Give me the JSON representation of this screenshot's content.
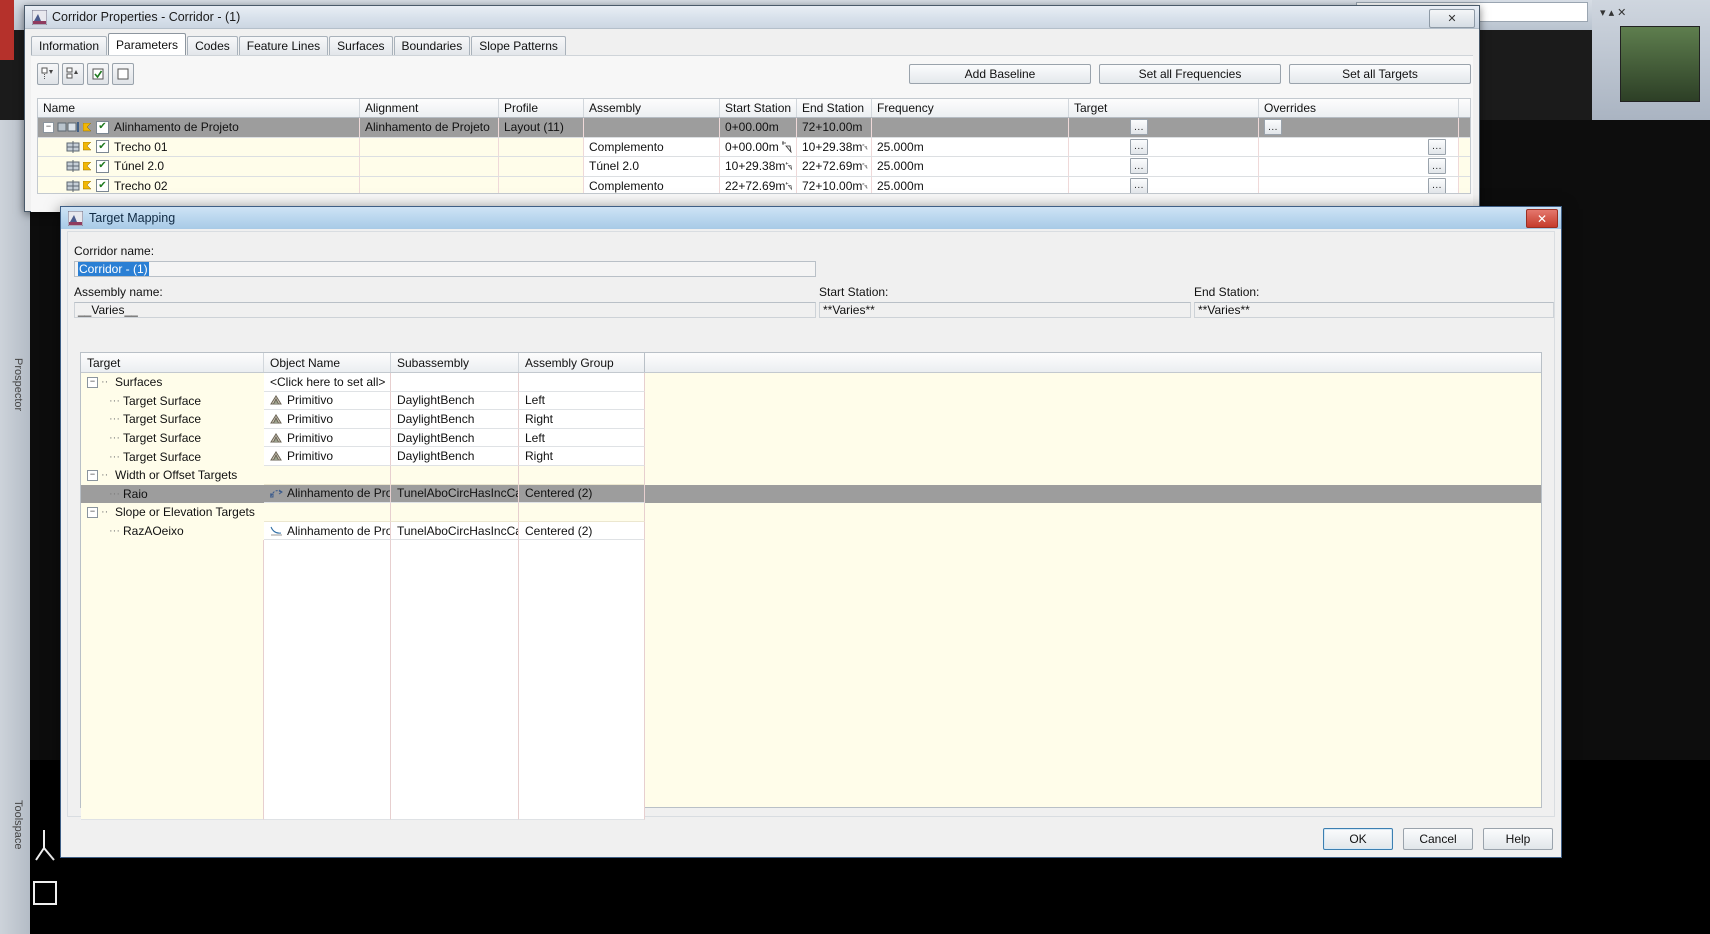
{
  "desktop": {
    "toolspace_label_1": "Prospector",
    "toolspace_label_2": "Toolspace"
  },
  "corridor_window": {
    "title": "Corridor Properties - Corridor - (1)",
    "icon": "autocad-civil3d-icon",
    "close_label": "✕",
    "tabs": [
      {
        "label": "Information",
        "active": false
      },
      {
        "label": "Parameters",
        "active": true
      },
      {
        "label": "Codes",
        "active": false
      },
      {
        "label": "Feature Lines",
        "active": false
      },
      {
        "label": "Surfaces",
        "active": false
      },
      {
        "label": "Boundaries",
        "active": false
      },
      {
        "label": "Slope Patterns",
        "active": false
      }
    ],
    "toolbar_icons": [
      "collapse-all-icon",
      "expand-all-icon",
      "check-all-icon",
      "uncheck-all-icon"
    ],
    "buttons": [
      {
        "label": "Add Baseline",
        "name": "add-baseline-button"
      },
      {
        "label": "Set all Frequencies",
        "name": "set-all-frequencies-button"
      },
      {
        "label": "Set all Targets",
        "name": "set-all-targets-button"
      }
    ],
    "grid": {
      "columns": [
        "Name",
        "Alignment",
        "Profile",
        "Assembly",
        "Start Station",
        "End Station",
        "Frequency",
        "Target",
        "Overrides"
      ],
      "rows": [
        {
          "name": "Alinhamento de Projeto",
          "level": 0,
          "checked": true,
          "selected": true,
          "alignment": "Alinhamento de Projeto",
          "profile": "Layout (11)",
          "assembly": "",
          "start_station": "0+00.00m",
          "end_station": "72+10.00m",
          "frequency": "",
          "target": "...",
          "overrides": "...",
          "has_row_target": false
        },
        {
          "name": "Trecho 01",
          "level": 1,
          "checked": true,
          "selected": false,
          "alignment": "",
          "profile": "",
          "assembly": "Complemento",
          "start_station": "0+00.00m",
          "end_station": "10+29.38m",
          "frequency": "25.000m",
          "target": "...",
          "overrides": "...",
          "has_row_target": true
        },
        {
          "name": "Túnel 2.0",
          "level": 1,
          "checked": true,
          "selected": false,
          "alignment": "",
          "profile": "",
          "assembly": "Túnel 2.0",
          "start_station": "10+29.38m",
          "end_station": "22+72.69m",
          "frequency": "25.000m",
          "target": "...",
          "overrides": "...",
          "has_row_target": true
        },
        {
          "name": "Trecho 02",
          "level": 1,
          "checked": true,
          "selected": false,
          "alignment": "",
          "profile": "",
          "assembly": "Complemento",
          "start_station": "22+72.69m",
          "end_station": "72+10.00m",
          "frequency": "25.000m",
          "target": "...",
          "overrides": "...",
          "has_row_target": true
        }
      ]
    }
  },
  "target_mapping": {
    "title": "Target Mapping",
    "icon": "autocad-civil3d-icon",
    "close_label": "✕",
    "corridor_name_label": "Corridor name:",
    "corridor_name_value": "Corridor - (1)",
    "assembly_name_label": "Assembly name:",
    "assembly_name_value": "__Varies__",
    "start_station_label": "Start Station:",
    "start_station_value": "**Varies**",
    "end_station_label": "End Station:",
    "end_station_value": "**Varies**",
    "grid": {
      "columns": [
        "Target",
        "Object Name",
        "Subassembly",
        "Assembly Group"
      ],
      "rows": [
        {
          "target": "Surfaces",
          "kind": "group",
          "indent": 0,
          "expander": "−",
          "object_name": "<Click here to set all>",
          "object_icon": "none",
          "subassembly": "",
          "assembly_group": "",
          "selected": false
        },
        {
          "target": "Target Surface",
          "kind": "item",
          "indent": 1,
          "expander": "",
          "object_name": "Primitivo",
          "object_icon": "surface-icon",
          "subassembly": "DaylightBench",
          "assembly_group": "Left",
          "selected": false
        },
        {
          "target": "Target Surface",
          "kind": "item",
          "indent": 1,
          "expander": "",
          "object_name": "Primitivo",
          "object_icon": "surface-icon",
          "subassembly": "DaylightBench",
          "assembly_group": "Right",
          "selected": false
        },
        {
          "target": "Target Surface",
          "kind": "item",
          "indent": 1,
          "expander": "",
          "object_name": "Primitivo",
          "object_icon": "surface-icon",
          "subassembly": "DaylightBench",
          "assembly_group": "Left",
          "selected": false
        },
        {
          "target": "Target Surface",
          "kind": "item",
          "indent": 1,
          "expander": "",
          "object_name": "Primitivo",
          "object_icon": "surface-icon",
          "subassembly": "DaylightBench",
          "assembly_group": "Right",
          "selected": false
        },
        {
          "target": "Width or Offset Targets",
          "kind": "group",
          "indent": 0,
          "expander": "−",
          "object_name": "",
          "object_icon": "none",
          "subassembly": "",
          "assembly_group": "",
          "selected": false
        },
        {
          "target": "Raio",
          "kind": "item",
          "indent": 1,
          "expander": "",
          "object_name": "Alinhamento de Pro...",
          "object_icon": "alignment-icon",
          "subassembly": "TunelAboCircHasIncCa...",
          "assembly_group": "Centered (2)",
          "selected": true
        },
        {
          "target": "Slope or Elevation Targets",
          "kind": "group",
          "indent": 0,
          "expander": "−",
          "object_name": "",
          "object_icon": "none",
          "subassembly": "",
          "assembly_group": "",
          "selected": false
        },
        {
          "target": "RazAOeixo",
          "kind": "item",
          "indent": 1,
          "expander": "",
          "object_name": "Alinhamento de Pro...",
          "object_icon": "profile-icon",
          "subassembly": "TunelAboCircHasIncCa...",
          "assembly_group": "Centered (2)",
          "selected": false
        }
      ]
    },
    "buttons": [
      {
        "label": "OK",
        "name": "ok-button",
        "default": true
      },
      {
        "label": "Cancel",
        "name": "cancel-button",
        "default": false
      },
      {
        "label": "Help",
        "name": "help-button",
        "default": false
      }
    ]
  }
}
